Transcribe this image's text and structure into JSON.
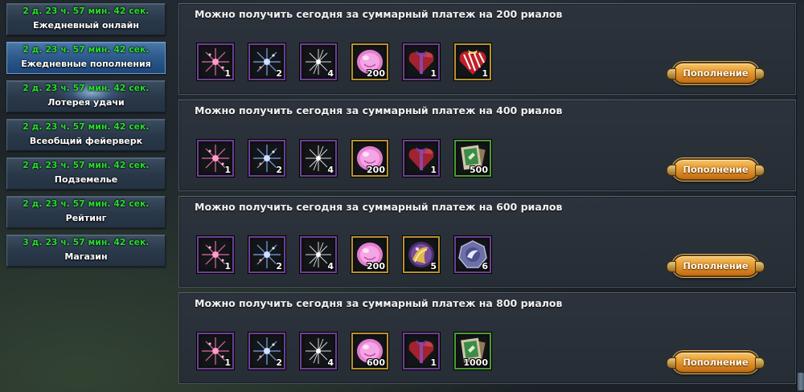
{
  "sidebar": {
    "items": [
      {
        "timer": "2 д. 23 ч. 57 мин. 42 сек.",
        "label": "Ежедневный онлайн"
      },
      {
        "timer": "2 д. 23 ч. 57 мин. 42 сек.",
        "label": "Ежедневные пополнения",
        "active": true
      },
      {
        "timer": "2 д. 23 ч. 57 мин. 42 сек.",
        "label": "Лотерея удачи"
      },
      {
        "timer": "2 д. 23 ч. 57 мин. 42 сек.",
        "label": "Всеобщий фейерверк"
      },
      {
        "timer": "2 д. 23 ч. 57 мин. 42 сек.",
        "label": "Подземелье"
      },
      {
        "timer": "2 д. 23 ч. 57 мин. 42 сек.",
        "label": "Рейтинг"
      },
      {
        "timer": "3 д. 23 ч. 57 мин. 42 сек.",
        "label": "Магазин"
      }
    ]
  },
  "rewards": [
    {
      "title": "Можно получить сегодня за суммарный платеж на 200 риалов",
      "button": "Пополнение",
      "items": [
        {
          "icon": "pink-firework-icon",
          "qty": "1"
        },
        {
          "icon": "blue-firework-icon",
          "qty": "2"
        },
        {
          "icon": "white-firework-icon",
          "qty": "4"
        },
        {
          "icon": "pink-gem-icon",
          "qty": "200"
        },
        {
          "icon": "heart-gift-box-icon",
          "qty": "1"
        },
        {
          "icon": "striped-heart-gift-icon",
          "qty": "1"
        }
      ]
    },
    {
      "title": "Можно получить сегодня за суммарный платеж на 400 риалов",
      "button": "Пополнение",
      "items": [
        {
          "icon": "pink-firework-icon",
          "qty": "1"
        },
        {
          "icon": "blue-firework-icon",
          "qty": "2"
        },
        {
          "icon": "white-firework-icon",
          "qty": "4"
        },
        {
          "icon": "pink-gem-icon",
          "qty": "200"
        },
        {
          "icon": "heart-gift-box-icon",
          "qty": "1"
        },
        {
          "icon": "scroll-cards-icon",
          "qty": "500"
        }
      ]
    },
    {
      "title": "Можно получить сегодня за суммарный платеж на 600 риалов",
      "button": "Пополнение",
      "items": [
        {
          "icon": "pink-firework-icon",
          "qty": "1"
        },
        {
          "icon": "blue-firework-icon",
          "qty": "2"
        },
        {
          "icon": "white-firework-icon",
          "qty": "4"
        },
        {
          "icon": "pink-gem-icon",
          "qty": "200"
        },
        {
          "icon": "golden-orb-icon",
          "qty": "5"
        },
        {
          "icon": "wing-badge-icon",
          "qty": "6"
        }
      ]
    },
    {
      "title": "Можно получить сегодня за суммарный платеж на 800 риалов",
      "button": "Пополнение",
      "items": [
        {
          "icon": "pink-firework-icon",
          "qty": "1"
        },
        {
          "icon": "blue-firework-icon",
          "qty": "2"
        },
        {
          "icon": "white-firework-icon",
          "qty": "4"
        },
        {
          "icon": "pink-gem-icon",
          "qty": "600"
        },
        {
          "icon": "heart-gift-box-icon",
          "qty": "1"
        },
        {
          "icon": "scroll-cards-icon",
          "qty": "1000"
        }
      ]
    }
  ],
  "colors": {
    "timer": "#26e02a",
    "button_orange": "#e89a2e",
    "active_tab": "#2f5b8d"
  }
}
